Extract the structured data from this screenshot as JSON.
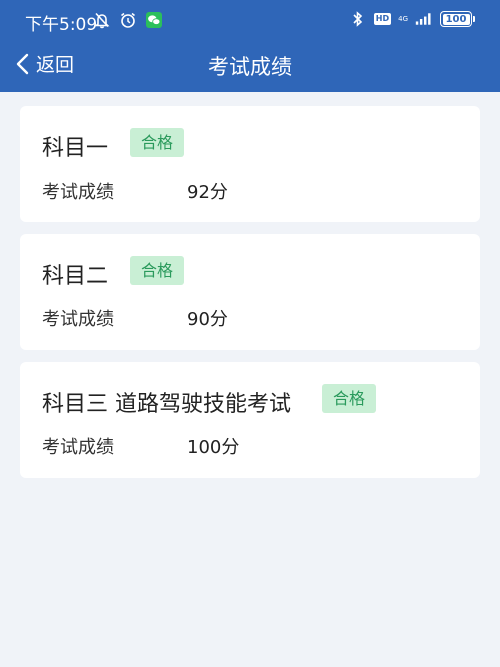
{
  "status_bar": {
    "time": "下午5:09",
    "hd": "HD",
    "network": "4G",
    "battery": "100"
  },
  "nav": {
    "back_label": "返回",
    "title": "考试成绩"
  },
  "subjects": [
    {
      "name": "科目一",
      "result": "合格",
      "score_label": "考试成绩",
      "score": "92分"
    },
    {
      "name": "科目二",
      "result": "合格",
      "score_label": "考试成绩",
      "score": "90分"
    },
    {
      "name": "科目三 道路驾驶技能考试",
      "result": "合格",
      "score_label": "考试成绩",
      "score": "100分"
    }
  ],
  "colors": {
    "header_bg": "#2f66b8",
    "page_bg": "#f0f3f8",
    "pass_badge_bg": "#c9efd5",
    "pass_badge_text": "#2a9a5c"
  }
}
